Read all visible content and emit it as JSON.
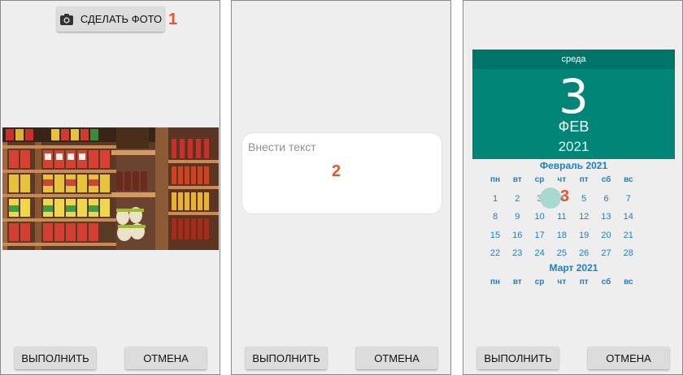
{
  "panel1": {
    "photo_button_label": "СДЕЛАТЬ ФОТО",
    "camera_icon": "camera-icon",
    "marker": "1",
    "execute_label": "ВЫПОЛНИТЬ",
    "cancel_label": "ОТМЕНА"
  },
  "panel2": {
    "text_placeholder": "Внести текст",
    "marker": "2",
    "execute_label": "ВЫПОЛНИТЬ",
    "cancel_label": "ОТМЕНА"
  },
  "panel3": {
    "day_name": "среда",
    "day_number": "3",
    "month_short": "ФЕВ",
    "year": "2021",
    "month1_title": "Февраль 2021",
    "weekdays": [
      "пн",
      "вт",
      "ср",
      "чт",
      "пт",
      "сб",
      "вс"
    ],
    "weeks": [
      [
        "1",
        "2",
        "3",
        "4",
        "5",
        "6",
        "7"
      ],
      [
        "8",
        "9",
        "10",
        "11",
        "12",
        "13",
        "14"
      ],
      [
        "15",
        "16",
        "17",
        "18",
        "19",
        "20",
        "21"
      ],
      [
        "22",
        "23",
        "24",
        "25",
        "26",
        "27",
        "28"
      ]
    ],
    "selected_day": "3",
    "month2_title": "Март 2021",
    "marker": "3",
    "execute_label": "ВЫПОЛНИТЬ",
    "cancel_label": "ОТМЕНА"
  },
  "colors": {
    "accent": "#008577",
    "calendar_text": "#1f7ec2",
    "marker": "#e8542a"
  }
}
